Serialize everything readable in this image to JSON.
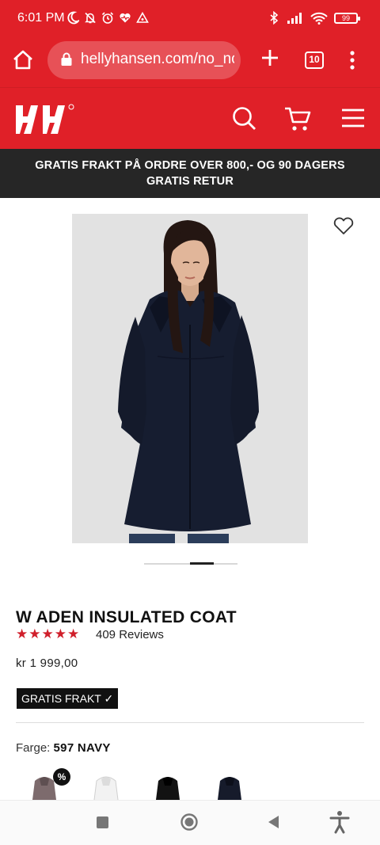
{
  "status_bar": {
    "time": "6:01 PM",
    "battery": "99",
    "left_icons": [
      "moon-icon",
      "bell-off-icon",
      "alarm-icon",
      "heart-rate-icon",
      "location-triangle-icon"
    ],
    "right_icons": [
      "bluetooth-icon",
      "signal-icon",
      "wifi-icon",
      "battery-icon"
    ]
  },
  "browser": {
    "url": "hellyhansen.com/no_no",
    "tab_count": "10"
  },
  "site": {
    "brand_color": "#e02028",
    "promo_text": "GRATIS FRAKT PÅ ORDRE OVER 800,- OG 90 DAGERS GRATIS RETUR"
  },
  "product": {
    "title": "W ADEN INSULATED COAT",
    "rating": 5,
    "reviews": "409 Reviews",
    "price": "kr 1 999,00",
    "badge": "GRATIS FRAKT ✓",
    "color_label": "Farge:",
    "color_value": "597 NAVY",
    "image_position": "2 of 4",
    "swatches": [
      {
        "color": "#7b6a6c",
        "sale": "%"
      },
      {
        "color": "#f4f4f4"
      },
      {
        "color": "#111111"
      },
      {
        "color": "#151a2a"
      }
    ]
  }
}
